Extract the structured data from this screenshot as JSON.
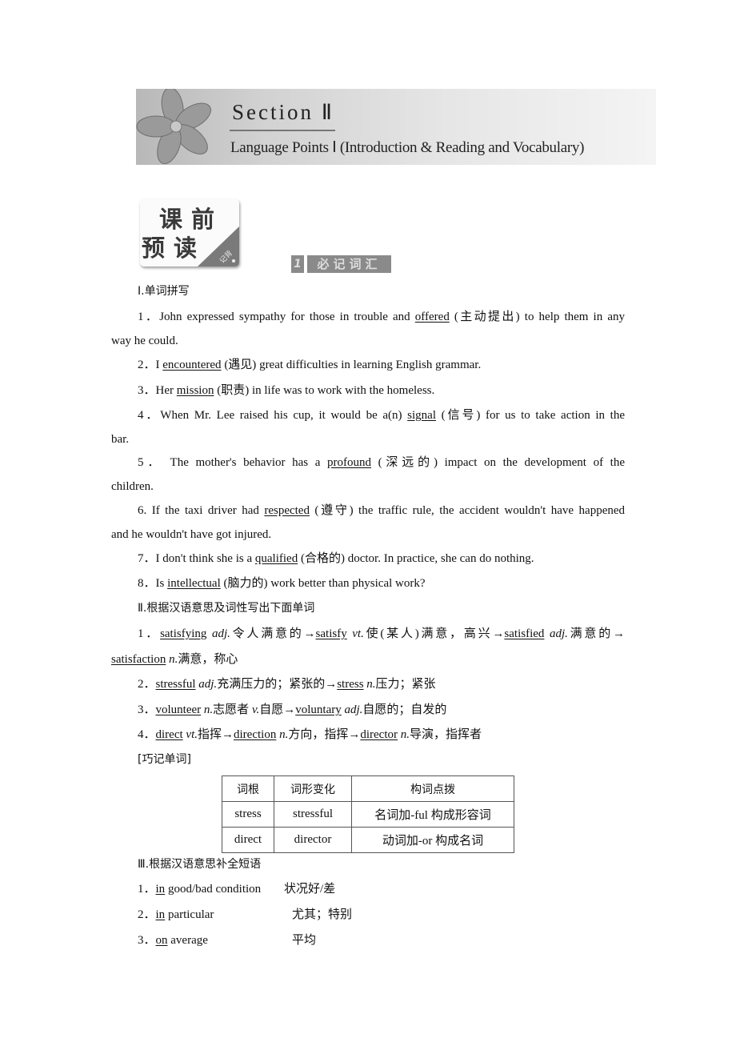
{
  "banner": {
    "title": "Section Ⅱ",
    "subtitle": "Language Points Ⅰ (Introduction & Reading and Vocabulary)"
  },
  "badge": {
    "line1": "课前",
    "line2": "预读",
    "corner": "记背"
  },
  "tag": {
    "number": "1",
    "label": "必记词汇"
  },
  "part1": {
    "heading": "Ⅰ.单词拼写",
    "items": [
      {
        "num": "1．",
        "before": "John expressed sympathy for those in trouble and ",
        "answer": "offered",
        "hint": " (主动提出)",
        "after": " to help them in any",
        "cont": "way he could."
      },
      {
        "num": "2．",
        "before": "I ",
        "answer": "encountered",
        "hint": " (遇见)",
        "after": " great difficulties in learning English grammar."
      },
      {
        "num": "3．",
        "before": "Her ",
        "answer": "mission",
        "hint": " (职责)",
        "after": " in life was to work with the homeless."
      },
      {
        "num": "4．",
        "before": "When Mr. Lee raised his cup, it would be a(n) ",
        "answer": "signal",
        "hint": " (信号)",
        "after": " for us to take action in the",
        "cont": "bar."
      },
      {
        "num": "5．",
        "before": "The mother's behavior has a ",
        "answer": "profound",
        "hint": " (深远的)",
        "after": " impact on the development of the",
        "cont": "children."
      },
      {
        "num": "6.",
        "before": "If the taxi driver had ",
        "answer": "respected",
        "hint": " (遵守)",
        "after": " the traffic rule, the accident wouldn't have happened",
        "cont": "and he wouldn't have got injured."
      },
      {
        "num": "7．",
        "before": "I don't think she is a ",
        "answer": "qualified",
        "hint": " (合格的)",
        "after": " doctor. In practice, she can do nothing."
      },
      {
        "num": "8．",
        "before": "Is ",
        "answer": "intellectual",
        "hint": " (脑力的)",
        "after": " work better than physical work?"
      }
    ]
  },
  "part2": {
    "heading": "Ⅱ.根据汉语意思及词性写出下面单词",
    "item1": {
      "num": "1．",
      "w1": "satisfying",
      "p1": "adj.",
      "m1": "令人满意的→",
      "w2": "satisfy",
      "p2": "vt.",
      "m2": "使(某人)满意，高兴→",
      "w3": "satisfied",
      "p3": "adj.",
      "m3": "满意的→",
      "w4": "satisfaction",
      "p4": "n.",
      "m4": "满意，称心"
    },
    "item2": {
      "num": "2．",
      "w1": "stressful",
      "p1": "adj.",
      "m1": "充满压力的；紧张的→",
      "w2": "stress",
      "p2": "n.",
      "m2": "压力；紧张"
    },
    "item3": {
      "num": "3．",
      "w1": "volunteer",
      "p1": "n.",
      "m1": "志愿者 ",
      "p1b": "v.",
      "m1b": "自愿→",
      "w2": "voluntary",
      "p2": "adj.",
      "m2": "自愿的；自发的"
    },
    "item4": {
      "num": "4．",
      "w1": "direct",
      "p1": "vt.",
      "m1": "指挥→",
      "w2": "direction",
      "p2": "n.",
      "m2": "方向，指挥→",
      "w3": "director",
      "p3": "n.",
      "m3": "导演，指挥者"
    },
    "tip_label": "[巧记单词]",
    "table": {
      "headers": [
        "词根",
        "词形变化",
        "构词点拨"
      ],
      "rows": [
        [
          "stress",
          "stressful",
          "名词加-ful 构成形容词"
        ],
        [
          "direct",
          "director",
          "动词加-or 构成名词"
        ]
      ]
    }
  },
  "part3": {
    "heading": "Ⅲ.根据汉语意思补全短语",
    "items": [
      {
        "num": "1．",
        "answer": "in",
        "rest": " good/bad condition",
        "meaning": "状况好/差"
      },
      {
        "num": "2．",
        "answer": "in",
        "rest": " particular",
        "meaning": "尤其；特别"
      },
      {
        "num": "3．",
        "answer": "on",
        "rest": " average",
        "meaning": "平均"
      }
    ]
  }
}
